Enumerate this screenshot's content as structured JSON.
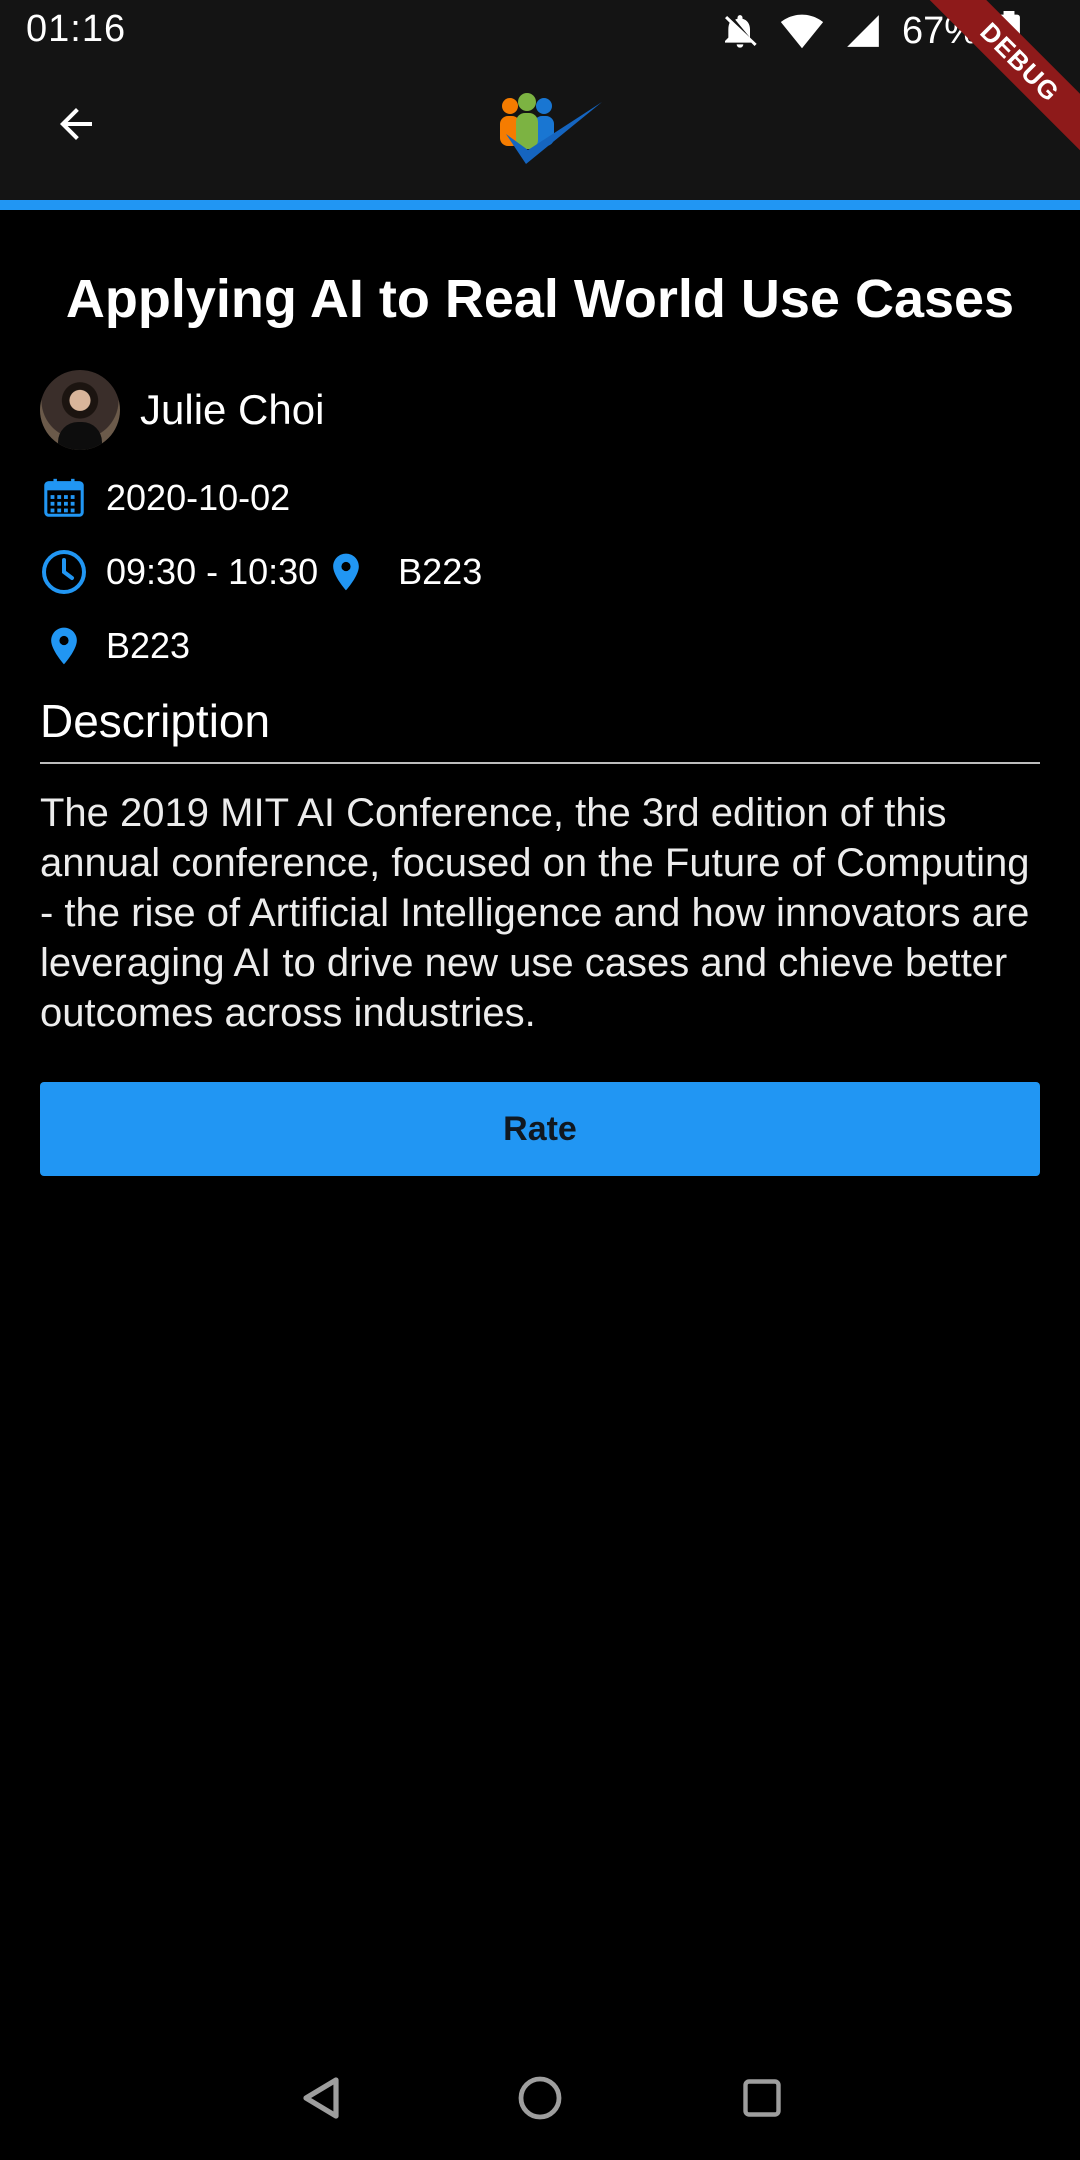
{
  "status_bar": {
    "time": "01:16",
    "battery": "67%"
  },
  "app_bar": {
    "debug_label": "DEBUG",
    "accent_color": "#2196F3"
  },
  "session": {
    "title": "Applying AI to Real World Use Cases",
    "speaker": "Julie Choi",
    "date": "2020-10-02",
    "time": "09:30 - 10:30",
    "room_inline": "B223",
    "room": "B223",
    "description_heading": "Description",
    "description": "The 2019 MIT AI Conference, the 3rd edition of this annual conference, focused on the Future of Computing - the rise of Artificial Intelligence and how innovators are leveraging AI to drive new use cases and chieve better outcomes across industries."
  },
  "actions": {
    "rate_label": "Rate"
  },
  "icons": {
    "back": "arrow-back-icon",
    "calendar": "calendar-icon",
    "clock": "clock-icon",
    "location": "location-pin-icon"
  }
}
